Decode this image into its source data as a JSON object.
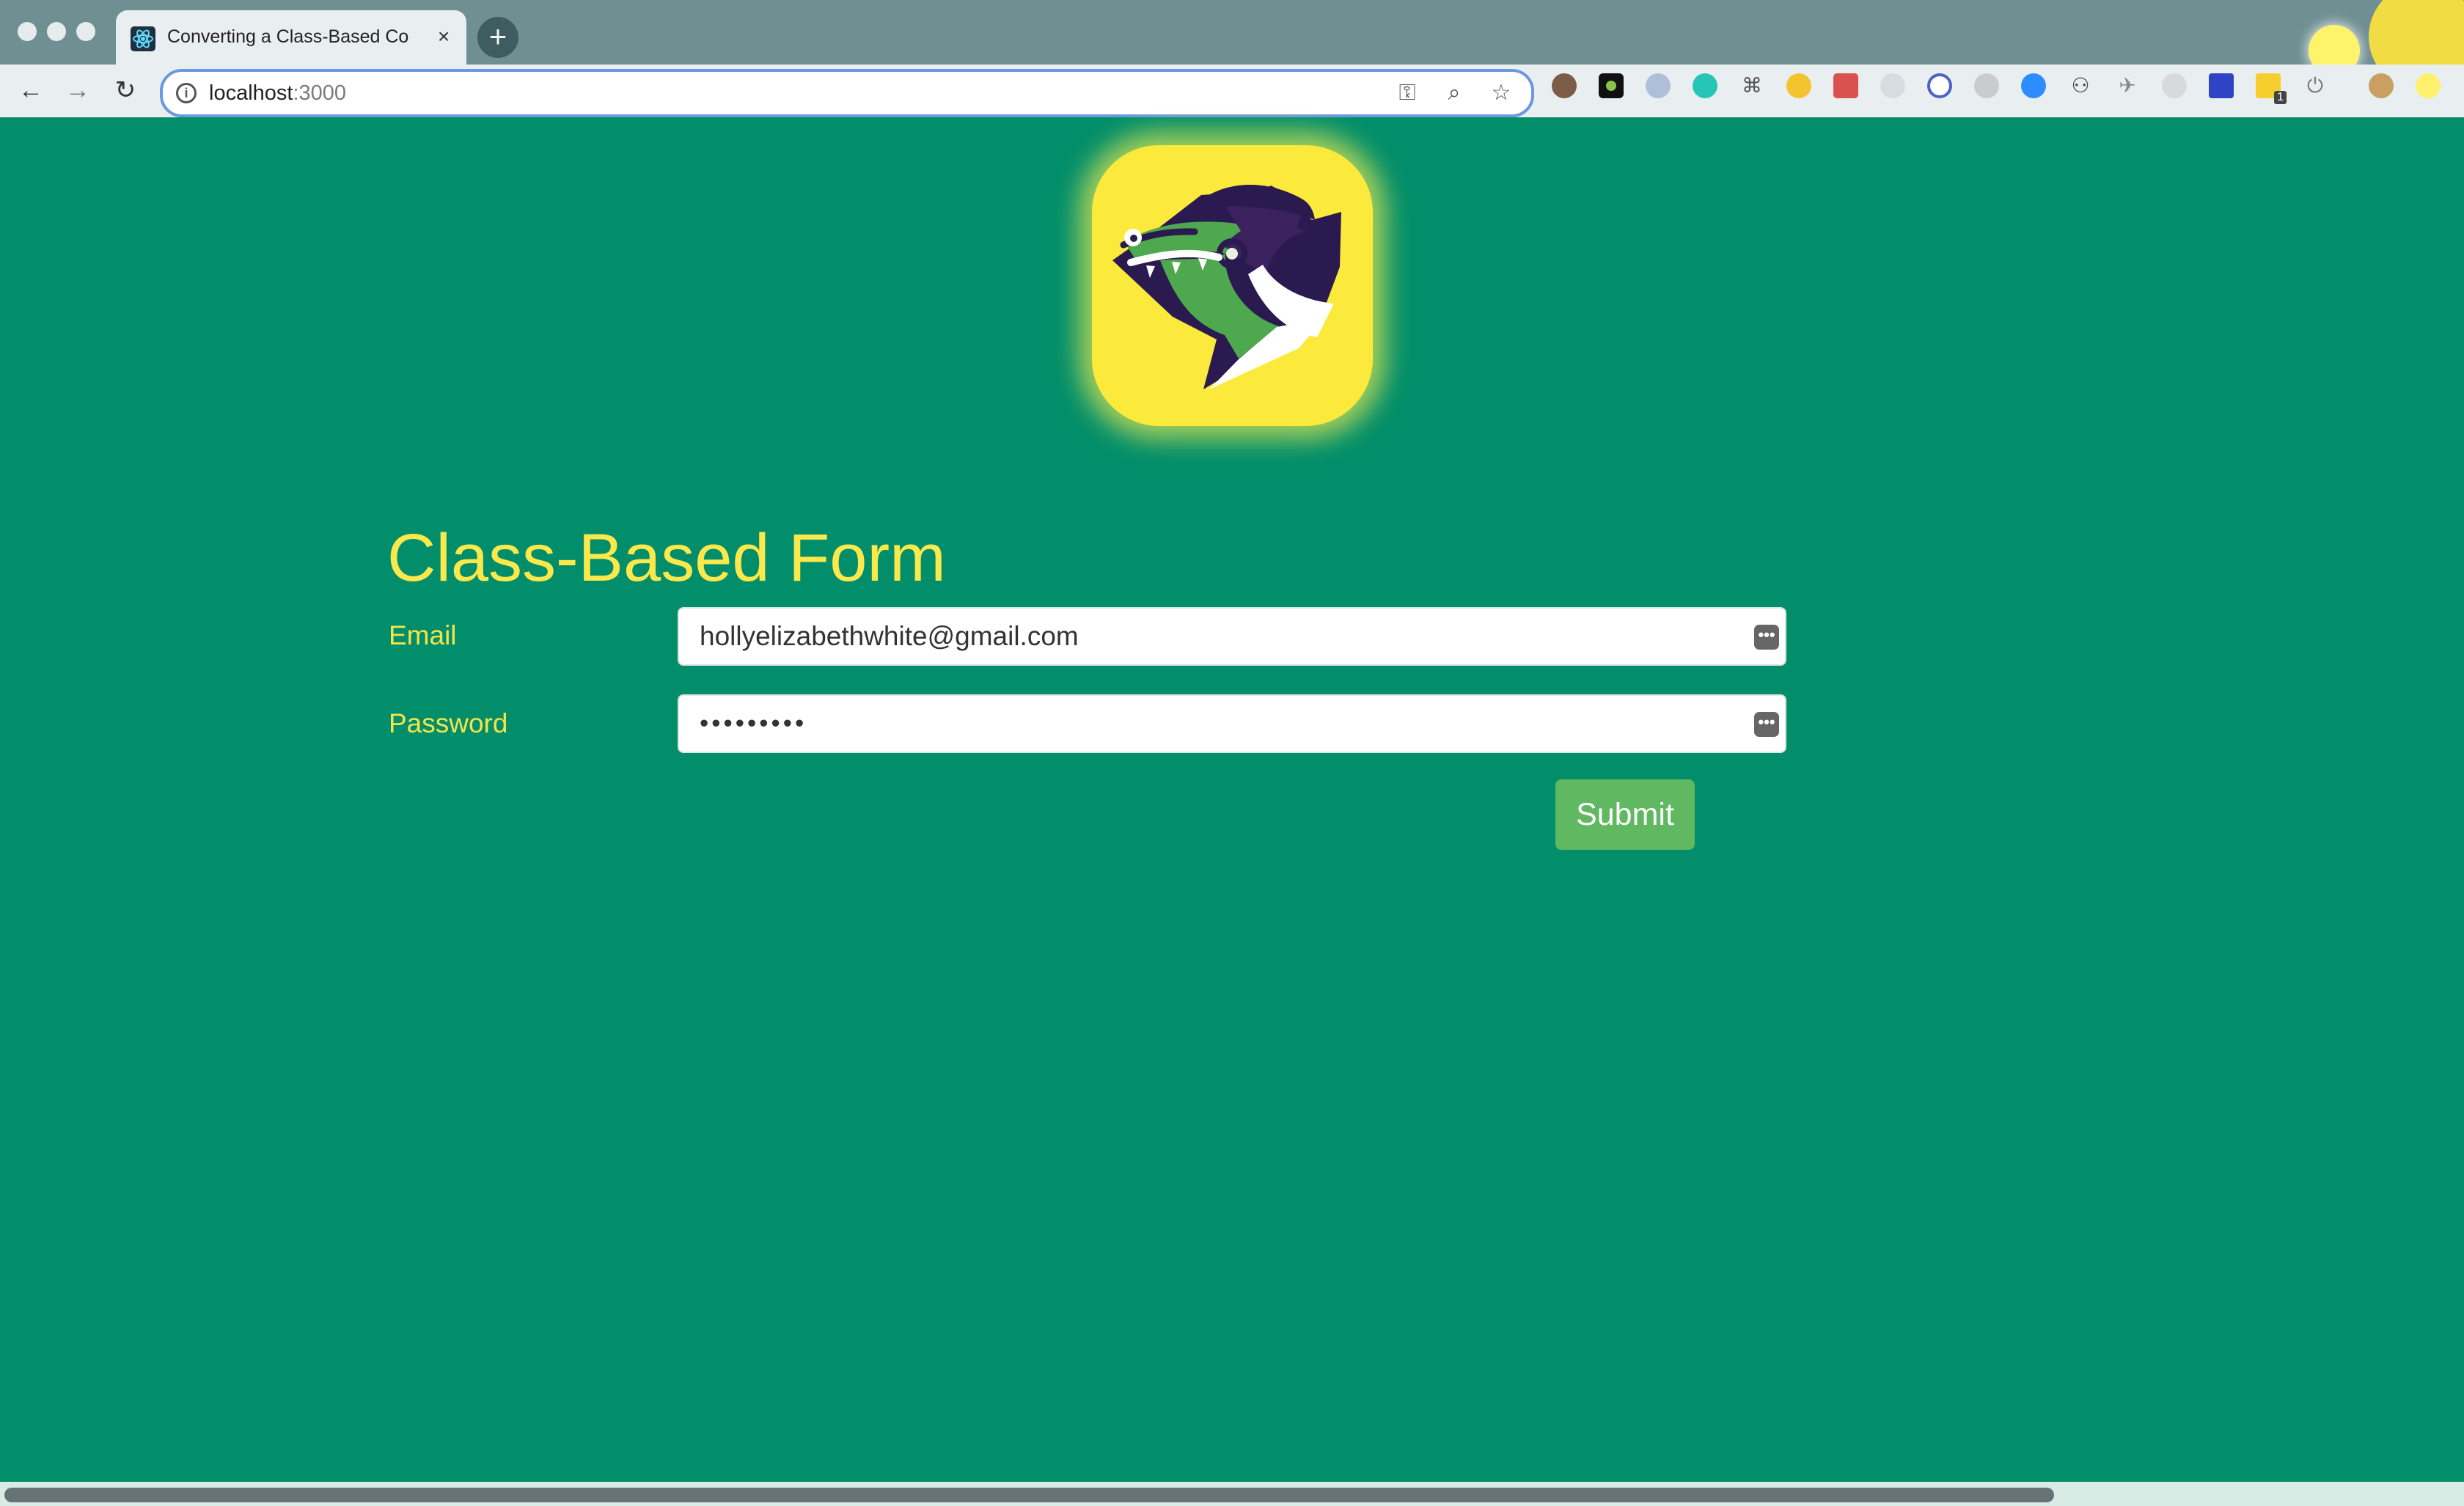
{
  "browser": {
    "tab_title": "Converting a Class-Based Com",
    "close_glyph": "×",
    "new_tab_glyph": "+",
    "back_glyph": "←",
    "forward_glyph": "→",
    "reload_glyph": "↻",
    "url_host": "localhost",
    "url_port": ":3000",
    "info_glyph": "i",
    "key_glyph": "⚿",
    "zoom_glyph": "⌕",
    "star_glyph": "☆",
    "extension_badge": "1",
    "icons": [
      "react-icon",
      "info-icon",
      "key-icon",
      "zoom-icon",
      "star-icon",
      "extension-icons",
      "sun-icon"
    ]
  },
  "form": {
    "title": "Class-Based Form",
    "email_label": "Email",
    "email_value": "hollyelizabethwhite@gmail.com",
    "password_label": "Password",
    "password_value": "•••••••••",
    "password_manager_glyph": "•••",
    "submit_label": "Submit"
  },
  "colors": {
    "page_background": "#028e6a",
    "title_color": "#fbe84a",
    "label_color": "#f4e44a",
    "submit_background": "#60b861",
    "logo_background": "#fbea3b",
    "gator_purple": "#3b225e",
    "gator_green": "#4ea84d"
  }
}
